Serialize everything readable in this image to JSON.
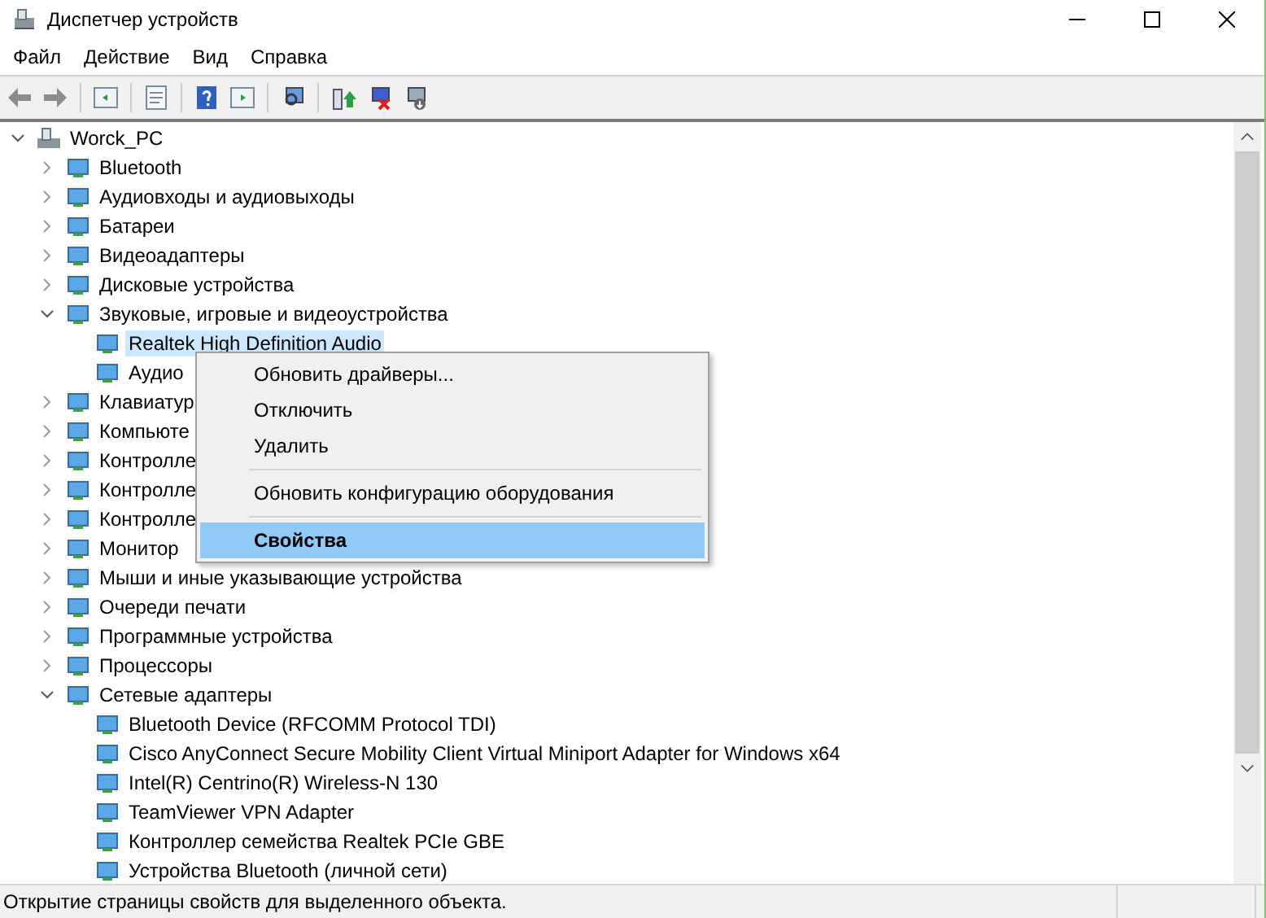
{
  "window": {
    "title": "Диспетчер устройств"
  },
  "menu": [
    "Файл",
    "Действие",
    "Вид",
    "Справка"
  ],
  "tree": [
    {
      "label": "Worck_PC",
      "expanded": true,
      "selected": false,
      "children": [
        {
          "label": "Bluetooth",
          "expanded": false,
          "selected": false
        },
        {
          "label": "Аудиовходы и аудиовыходы",
          "expanded": false,
          "selected": false
        },
        {
          "label": "Батареи",
          "expanded": false,
          "selected": false
        },
        {
          "label": "Видеоадаптеры",
          "expanded": false,
          "selected": false
        },
        {
          "label": "Дисковые устройства",
          "expanded": false,
          "selected": false
        },
        {
          "label": "Звуковые, игровые и видеоустройства",
          "expanded": true,
          "selected": false,
          "children": [
            {
              "label": "Realtek High Definition Audio",
              "selected": true
            },
            {
              "label": "Аудио",
              "selected": false
            }
          ]
        },
        {
          "label": "Клавиатур",
          "expanded": false,
          "selected": false
        },
        {
          "label": "Компьюте",
          "expanded": false,
          "selected": false
        },
        {
          "label": "Контролле",
          "expanded": false,
          "selected": false
        },
        {
          "label": "Контролле",
          "expanded": false,
          "selected": false
        },
        {
          "label": "Контролле",
          "expanded": false,
          "selected": false
        },
        {
          "label": "Монитор",
          "expanded": false,
          "selected": false
        },
        {
          "label": "Мыши и иные указывающие устройства",
          "expanded": false,
          "selected": false
        },
        {
          "label": "Очереди печати",
          "expanded": false,
          "selected": false
        },
        {
          "label": "Программные устройства",
          "expanded": false,
          "selected": false
        },
        {
          "label": "Процессоры",
          "expanded": false,
          "selected": false
        },
        {
          "label": "Сетевые адаптеры",
          "expanded": true,
          "selected": false,
          "children": [
            {
              "label": "Bluetooth Device (RFCOMM Protocol TDI)",
              "selected": false
            },
            {
              "label": "Cisco AnyConnect Secure Mobility Client Virtual Miniport Adapter for Windows x64",
              "selected": false
            },
            {
              "label": "Intel(R) Centrino(R) Wireless-N 130",
              "selected": false
            },
            {
              "label": "TeamViewer VPN Adapter",
              "selected": false
            },
            {
              "label": "Контроллер семейства Realtek PCIe GBE",
              "selected": false
            },
            {
              "label": "Устройства Bluetooth (личной сети)",
              "selected": false
            }
          ]
        }
      ]
    }
  ],
  "context_menu": [
    {
      "kind": "item",
      "label": "Обновить драйверы...",
      "selected": false,
      "default": false
    },
    {
      "kind": "item",
      "label": "Отключить",
      "selected": false,
      "default": false
    },
    {
      "kind": "item",
      "label": "Удалить",
      "selected": false,
      "default": false
    },
    {
      "kind": "separator"
    },
    {
      "kind": "item",
      "label": "Обновить конфигурацию оборудования",
      "selected": false,
      "default": false
    },
    {
      "kind": "separator"
    },
    {
      "kind": "item",
      "label": "Свойства",
      "selected": true,
      "default": true
    }
  ],
  "status_bar": "Открытие страницы свойств для выделенного объекта."
}
